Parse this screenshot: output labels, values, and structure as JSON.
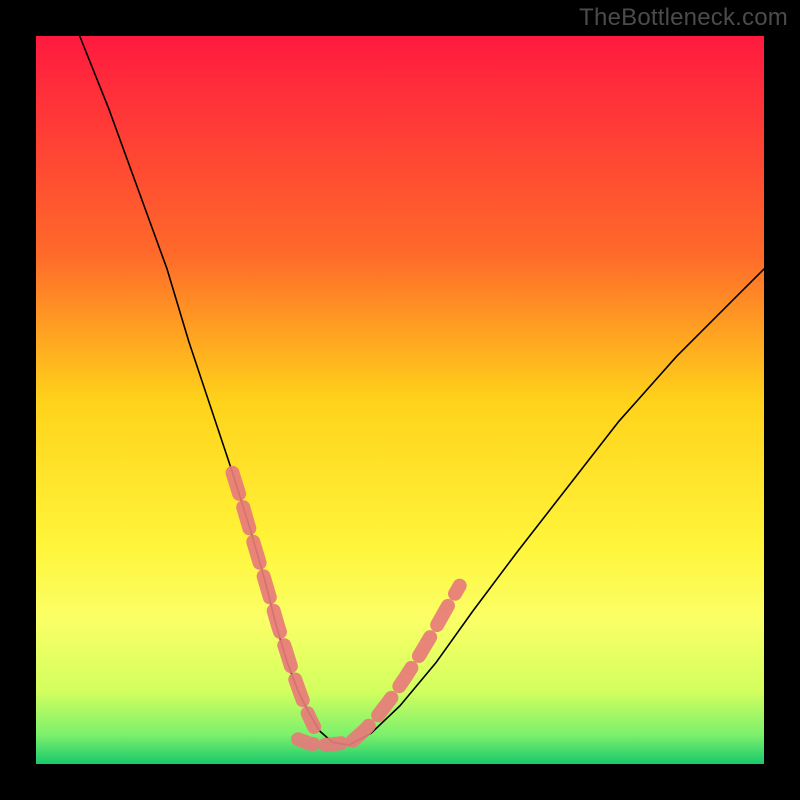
{
  "watermark": "TheBottleneck.com",
  "chart_data": {
    "type": "line",
    "title": "",
    "xlabel": "",
    "ylabel": "",
    "xlim": [
      0,
      100
    ],
    "ylim": [
      0,
      100
    ],
    "grid": false,
    "legend": false,
    "background_gradient": {
      "stops": [
        {
          "offset": 0.0,
          "color": "#ff1a3f"
        },
        {
          "offset": 0.3,
          "color": "#ff6a2a"
        },
        {
          "offset": 0.5,
          "color": "#ffd21a"
        },
        {
          "offset": 0.7,
          "color": "#fff53a"
        },
        {
          "offset": 0.8,
          "color": "#fbff66"
        },
        {
          "offset": 0.9,
          "color": "#d2ff5e"
        },
        {
          "offset": 0.96,
          "color": "#7cf06c"
        },
        {
          "offset": 1.0,
          "color": "#18c96b"
        }
      ]
    },
    "series": [
      {
        "name": "bottleneck-curve",
        "stroke": "#000000",
        "stroke_width": 1.6,
        "x": [
          6,
          10,
          14,
          18,
          21,
          24,
          27,
          29.5,
          31.5,
          33,
          34.5,
          36,
          37.5,
          39,
          40.7,
          43,
          46,
          50,
          55,
          60,
          66,
          73,
          80,
          88,
          96,
          100
        ],
        "y": [
          100,
          90,
          79,
          68,
          58,
          49,
          40,
          32,
          25,
          19,
          14,
          10,
          7,
          4.5,
          3.0,
          2.6,
          4.2,
          8,
          14,
          21,
          29,
          38,
          47,
          56,
          64,
          68
        ]
      }
    ],
    "overlays": [
      {
        "name": "dash-left",
        "type": "dotted-path",
        "stroke": "#e77b7b",
        "stroke_width": 14,
        "dash": [
          22,
          14
        ],
        "x": [
          27.0,
          28.4,
          29.7,
          31.0,
          32.2,
          33.3,
          34.4,
          35.4,
          36.4,
          37.3,
          38.2
        ],
        "y": [
          40.0,
          35.5,
          31.0,
          26.7,
          22.6,
          18.8,
          15.4,
          12.2,
          9.4,
          7.0,
          5.1
        ]
      },
      {
        "name": "dash-right",
        "type": "dotted-path",
        "stroke": "#e77b7b",
        "stroke_width": 14,
        "dash": [
          22,
          14
        ],
        "x": [
          43.5,
          45.2,
          47.0,
          48.9,
          50.8,
          52.7,
          54.6,
          56.4,
          58.2
        ],
        "y": [
          3.2,
          4.7,
          6.7,
          9.2,
          12.0,
          15.0,
          18.2,
          21.4,
          24.5
        ]
      },
      {
        "name": "trough-dots",
        "type": "dotted-path",
        "stroke": "#e77b7b",
        "stroke_width": 14,
        "dash": [
          16,
          12
        ],
        "x": [
          36.0,
          37.6,
          39.2,
          40.7,
          42.2,
          43.5
        ],
        "y": [
          3.4,
          2.8,
          2.6,
          2.7,
          2.9,
          3.2
        ]
      }
    ]
  }
}
